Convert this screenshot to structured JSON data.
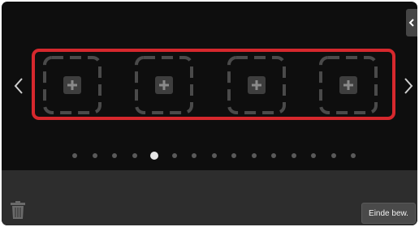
{
  "panel": {
    "collapse_icon": "chevron-left-icon",
    "nav_prev_icon": "chevron-left-icon",
    "nav_next_icon": "chevron-right-icon",
    "highlight_color": "#d6282d"
  },
  "slots": [
    {
      "icon": "plus-icon",
      "state": "empty"
    },
    {
      "icon": "plus-icon",
      "state": "empty"
    },
    {
      "icon": "plus-icon",
      "state": "empty"
    },
    {
      "icon": "plus-icon",
      "state": "empty"
    }
  ],
  "pagination": {
    "page_count": 15,
    "current_page": 5
  },
  "bottom_bar": {
    "trash_icon": "trash-icon",
    "end_edit_label": "Einde bew."
  }
}
